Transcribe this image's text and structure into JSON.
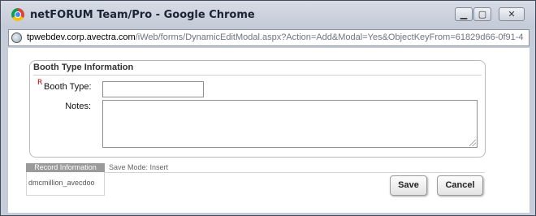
{
  "window": {
    "title": "netFORUM Team/Pro - Google Chrome",
    "minimize_glyph": "▁",
    "maximize_glyph": "▢",
    "close_glyph": "✕"
  },
  "address_bar": {
    "url_host": "tpwebdev.corp.avectra.com",
    "url_path": "/iWeb/forms/DynamicEditModal.aspx?Action=Add&Modal=Yes&ObjectKeyFrom=61829d66-0f91-4"
  },
  "form": {
    "section_title": "Booth Type Information",
    "required_marker": "R",
    "booth_type_label": "Booth Type:",
    "booth_type_value": "",
    "notes_label": "Notes:",
    "notes_value": ""
  },
  "record_info": {
    "tab_label": "Record Information",
    "save_mode": "Save Mode: Insert",
    "user": "dmcmillion_avecdoo"
  },
  "buttons": {
    "save": "Save",
    "cancel": "Cancel"
  },
  "colors": {
    "titlebar": "#c3c9d6",
    "required": "#cc0000",
    "record_tab": "#9a9a9a"
  }
}
